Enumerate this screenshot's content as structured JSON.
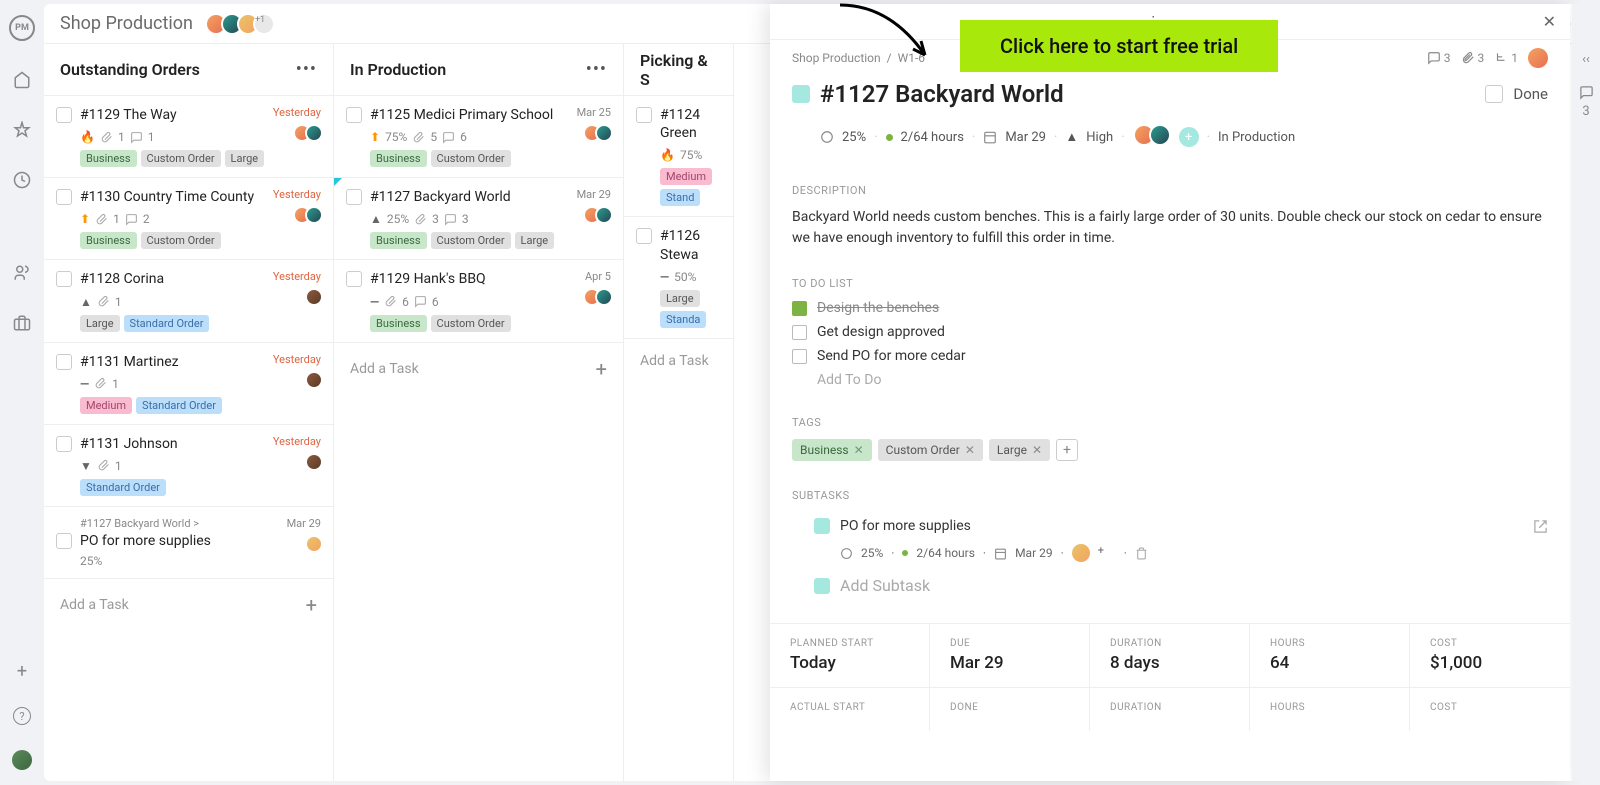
{
  "header": {
    "title": "Shop Production",
    "logo_text": "PM"
  },
  "cta": "Click here to start free trial",
  "columns": [
    {
      "title": "Outstanding Orders",
      "cards": [
        {
          "title": "#1129 The Way",
          "date": "Yesterday",
          "date_hot": true,
          "priority": "flame",
          "attach": "1",
          "comments": "1",
          "tags": [
            [
              "Business",
              "business"
            ],
            [
              "Custom Order",
              "custom"
            ],
            [
              "Large",
              "large"
            ]
          ],
          "avatars": [
            "a",
            "b"
          ]
        },
        {
          "title": "#1130 Country Time County",
          "date": "Yesterday",
          "date_hot": true,
          "priority": "up",
          "attach": "1",
          "comments": "2",
          "tags": [
            [
              "Business",
              "business"
            ],
            [
              "Custom Order",
              "custom"
            ]
          ],
          "avatars": [
            "a",
            "b"
          ]
        },
        {
          "title": "#1128 Corina",
          "date": "Yesterday",
          "date_hot": true,
          "priority": "caret-up",
          "attach": "1",
          "tags": [
            [
              "Large",
              "large"
            ],
            [
              "Standard Order",
              "standard"
            ]
          ],
          "avatars": [
            "d"
          ]
        },
        {
          "title": "#1131 Martinez",
          "date": "Yesterday",
          "date_hot": true,
          "priority": "dash",
          "attach": "1",
          "tags": [
            [
              "Medium",
              "medium"
            ],
            [
              "Standard Order",
              "standard"
            ]
          ],
          "avatars": [
            "d"
          ]
        },
        {
          "title": "#1131 Johnson",
          "date": "Yesterday",
          "date_hot": true,
          "priority": "caret-down",
          "attach": "1",
          "tags": [
            [
              "Standard Order",
              "standard"
            ]
          ],
          "avatars": [
            "d"
          ]
        },
        {
          "sub_of": "#1127 Backyard World >",
          "title": "PO for more supplies",
          "date": "Mar 29",
          "date_hot": false,
          "percent": "25%",
          "avatars": [
            "c"
          ]
        }
      ],
      "add_label": "Add a Task"
    },
    {
      "title": "In Production",
      "cards": [
        {
          "title": "#1125 Medici Primary School",
          "date": "Mar 25",
          "date_hot": false,
          "priority": "up",
          "percent_inline": "75%",
          "attach": "5",
          "comments": "6",
          "tags": [
            [
              "Business",
              "business"
            ],
            [
              "Custom Order",
              "custom"
            ]
          ],
          "avatars": [
            "a",
            "b"
          ]
        },
        {
          "title": "#1127 Backyard World",
          "date": "Mar 29",
          "date_hot": false,
          "priority": "caret-up",
          "percent_inline": "25%",
          "attach": "3",
          "comments": "3",
          "tags": [
            [
              "Business",
              "business"
            ],
            [
              "Custom Order",
              "custom"
            ],
            [
              "Large",
              "large"
            ]
          ],
          "avatars": [
            "a",
            "b"
          ],
          "corner": true
        },
        {
          "title": "#1129 Hank's BBQ",
          "date": "Apr 5",
          "date_hot": false,
          "priority": "dash",
          "attach": "6",
          "comments": "6",
          "tags": [
            [
              "Business",
              "business"
            ],
            [
              "Custom Order",
              "custom"
            ]
          ],
          "avatars": [
            "a",
            "b"
          ]
        }
      ],
      "add_label": "Add a Task"
    },
    {
      "title": "Picking & S",
      "cards": [
        {
          "title": "#1124 Green",
          "priority": "flame",
          "percent_inline": "75%",
          "tags": [
            [
              "Medium",
              "medium"
            ],
            [
              "Stand",
              "standard"
            ]
          ]
        },
        {
          "title": "#1126 Stewa",
          "priority": "dash",
          "percent_inline": "50%",
          "tags": [
            [
              "Large",
              "large"
            ],
            [
              "Standa",
              "standard"
            ]
          ]
        }
      ],
      "add_label": "Add a Task"
    }
  ],
  "detail": {
    "breadcrumb_project": "Shop Production",
    "breadcrumb_id": "W1-6",
    "comments_count": "3",
    "attach_count": "3",
    "subtask_count": "1",
    "title": "#1127 Backyard World",
    "done_label": "Done",
    "percent": "25%",
    "hours": "2/64 hours",
    "due": "Mar 29",
    "priority_label": "High",
    "status": "In Production",
    "desc_label": "DESCRIPTION",
    "description": "Backyard World needs custom benches. This is a fairly large order of 30 units. Double check our stock on cedar to ensure we have enough inventory to fulfill this order in time.",
    "todo_label": "TO DO LIST",
    "todos": [
      {
        "text": "Design the benches",
        "done": true
      },
      {
        "text": "Get design approved",
        "done": false
      },
      {
        "text": "Send PO for more cedar",
        "done": false
      }
    ],
    "add_todo": "Add To Do",
    "tags_label": "TAGS",
    "tags": [
      [
        "Business",
        "business"
      ],
      [
        "Custom Order",
        "custom"
      ],
      [
        "Large",
        "large"
      ]
    ],
    "subtasks_label": "SUBTASKS",
    "subtask": {
      "title": "PO for more supplies",
      "percent": "25%",
      "hours": "2/64 hours",
      "due": "Mar 29"
    },
    "add_subtask": "Add Subtask",
    "stats_planned": [
      {
        "label": "PLANNED START",
        "value": "Today"
      },
      {
        "label": "DUE",
        "value": "Mar 29"
      },
      {
        "label": "DURATION",
        "value": "8 days"
      },
      {
        "label": "HOURS",
        "value": "64"
      },
      {
        "label": "COST",
        "value": "$1,000"
      }
    ],
    "stats_actual": [
      {
        "label": "ACTUAL START"
      },
      {
        "label": "DONE"
      },
      {
        "label": "DURATION"
      },
      {
        "label": "HOURS"
      },
      {
        "label": "COST"
      }
    ]
  },
  "right_rail_count": "3"
}
